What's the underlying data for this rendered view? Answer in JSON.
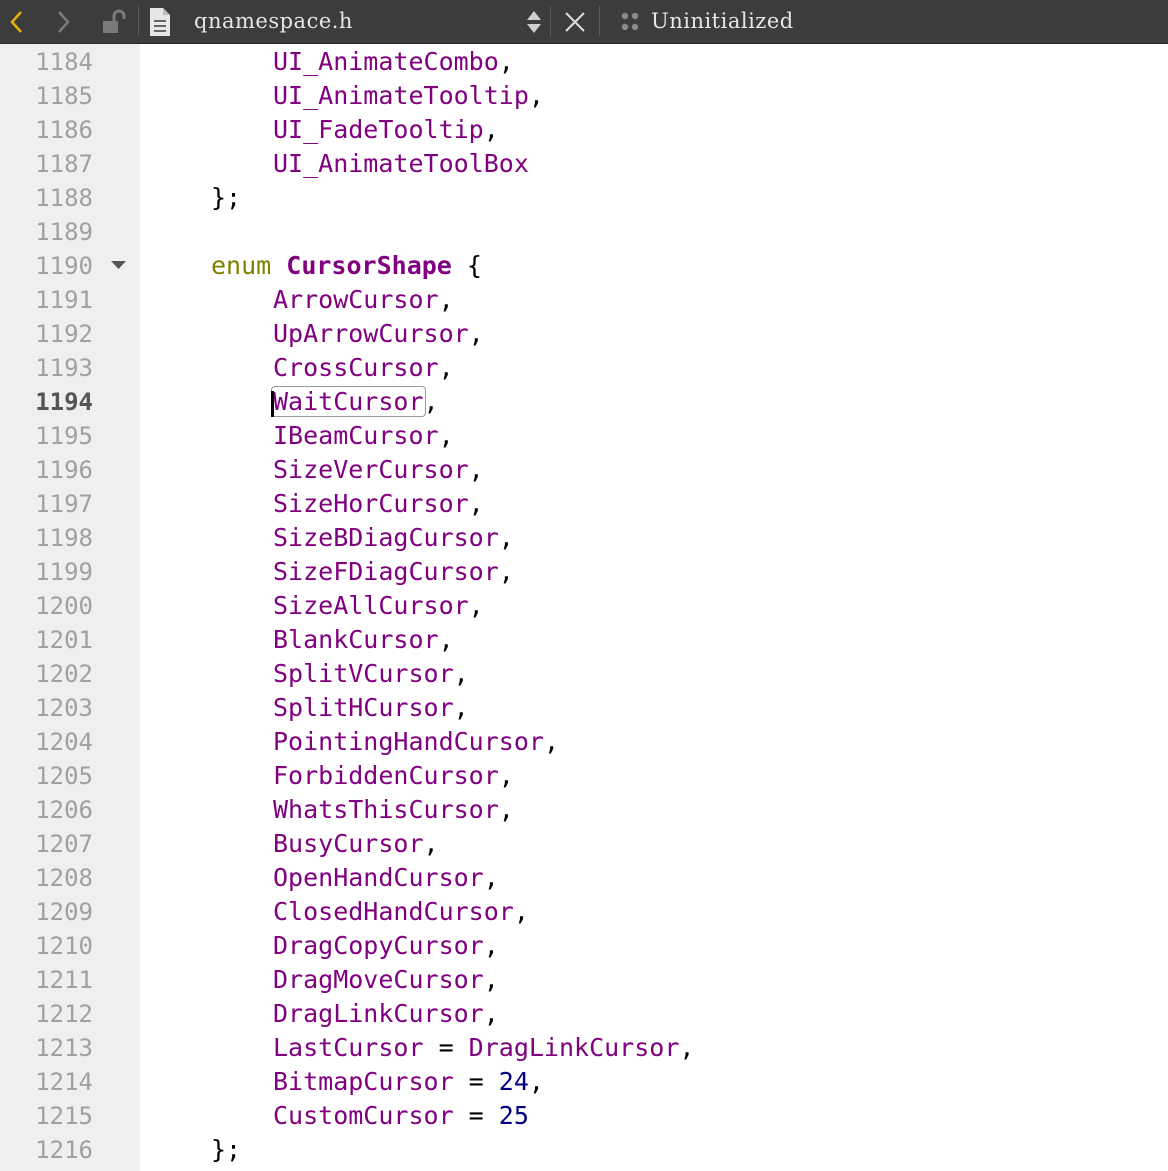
{
  "toolbar": {
    "back_icon": "chevron-left-icon",
    "forward_icon": "chevron-right-icon",
    "lock_icon": "unlocked-padlock-icon",
    "file_icon": "document-icon",
    "filename": "qnamespace.h",
    "close_icon": "close-icon",
    "symbol_text": "Uninitialized",
    "accent_color": "#e8b000"
  },
  "gutter": {
    "current_line": "1194",
    "folded_line": "1190"
  },
  "lines": [
    {
      "n": "1184",
      "t": "UI_AnimateCombo",
      "s": ","
    },
    {
      "n": "1185",
      "t": "UI_AnimateTooltip",
      "s": ","
    },
    {
      "n": "1186",
      "t": "UI_FadeTooltip",
      "s": ","
    },
    {
      "n": "1187",
      "t": "UI_AnimateToolBox",
      "s": ""
    },
    {
      "n": "1188",
      "t": "};"
    },
    {
      "n": "1189",
      "t": ""
    },
    {
      "n": "1190",
      "kw": "enum",
      "ty": "CursorShape",
      "t": "{"
    },
    {
      "n": "1191",
      "t": "ArrowCursor",
      "s": ","
    },
    {
      "n": "1192",
      "t": "UpArrowCursor",
      "s": ","
    },
    {
      "n": "1193",
      "t": "CrossCursor",
      "s": ","
    },
    {
      "n": "1194",
      "t": "WaitCursor",
      "s": ","
    },
    {
      "n": "1195",
      "t": "IBeamCursor",
      "s": ","
    },
    {
      "n": "1196",
      "t": "SizeVerCursor",
      "s": ","
    },
    {
      "n": "1197",
      "t": "SizeHorCursor",
      "s": ","
    },
    {
      "n": "1198",
      "t": "SizeBDiagCursor",
      "s": ","
    },
    {
      "n": "1199",
      "t": "SizeFDiagCursor",
      "s": ","
    },
    {
      "n": "1200",
      "t": "SizeAllCursor",
      "s": ","
    },
    {
      "n": "1201",
      "t": "BlankCursor",
      "s": ","
    },
    {
      "n": "1202",
      "t": "SplitVCursor",
      "s": ","
    },
    {
      "n": "1203",
      "t": "SplitHCursor",
      "s": ","
    },
    {
      "n": "1204",
      "t": "PointingHandCursor",
      "s": ","
    },
    {
      "n": "1205",
      "t": "ForbiddenCursor",
      "s": ","
    },
    {
      "n": "1206",
      "t": "WhatsThisCursor",
      "s": ","
    },
    {
      "n": "1207",
      "t": "BusyCursor",
      "s": ","
    },
    {
      "n": "1208",
      "t": "OpenHandCursor",
      "s": ","
    },
    {
      "n": "1209",
      "t": "ClosedHandCursor",
      "s": ","
    },
    {
      "n": "1210",
      "t": "DragCopyCursor",
      "s": ","
    },
    {
      "n": "1211",
      "t": "DragMoveCursor",
      "s": ","
    },
    {
      "n": "1212",
      "t": "DragLinkCursor",
      "s": ","
    },
    {
      "n": "1213",
      "t": "LastCursor",
      "op": " = ",
      "rhs": "DragLinkCursor",
      "s": ","
    },
    {
      "n": "1214",
      "t": "BitmapCursor",
      "op": " = ",
      "num": "24",
      "s": ","
    },
    {
      "n": "1215",
      "t": "CustomCursor",
      "op": " = ",
      "num": "25",
      "s": ""
    },
    {
      "n": "1216",
      "t": "};"
    }
  ]
}
